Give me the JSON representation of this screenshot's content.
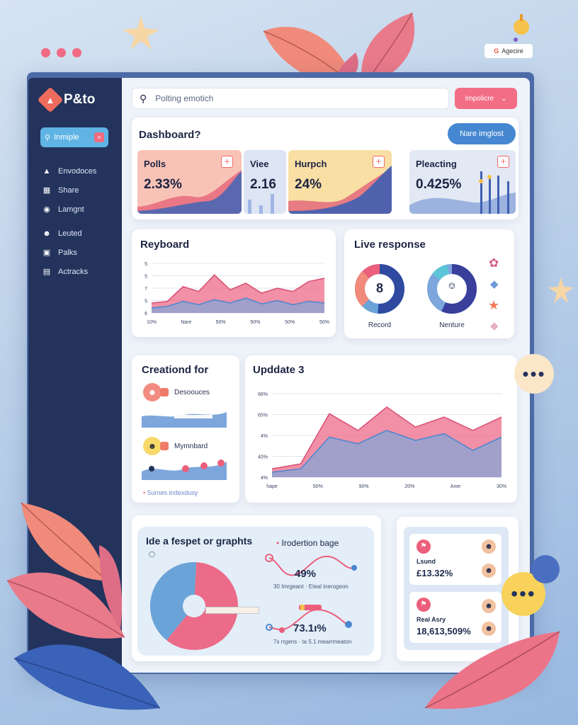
{
  "decor": {
    "top_badge": "Agecire",
    "window_dots": [
      "#f06b83",
      "#f06b83",
      "#f06b83"
    ]
  },
  "sidebar": {
    "brand": "P&to",
    "search_label": "Inmiple",
    "items": [
      {
        "icon": "home-icon",
        "label": "Envodoces"
      },
      {
        "icon": "grid-icon",
        "label": "Share"
      },
      {
        "icon": "bulb-icon",
        "label": "Lamgnt"
      },
      {
        "icon": "user-icon",
        "label": "Leuted"
      },
      {
        "icon": "inbox-icon",
        "label": "Palks"
      },
      {
        "icon": "doc-icon",
        "label": "Actracks"
      }
    ]
  },
  "topbar": {
    "search_placeholder": "Polting emotich",
    "dropdown_label": "Impolicre"
  },
  "dashboard": {
    "title": "Dashboard?",
    "new_button": "Nare imglost",
    "stats": [
      {
        "label": "Polls",
        "value": "2.33%"
      },
      {
        "label": "Viee",
        "value": "2.16"
      },
      {
        "label": "Hurpch",
        "value": "24%"
      },
      {
        "label": "Pleacting",
        "value": "0.425%"
      }
    ]
  },
  "reyboard": {
    "title": "Reyboard",
    "y_ticks": [
      "5",
      "5",
      "7",
      "5",
      "6"
    ],
    "x_ticks": [
      "10%",
      "Nare",
      "50%",
      "50%",
      "50%",
      "50%"
    ]
  },
  "live": {
    "title": "Live response",
    "donut1_value": "8",
    "donut1_label": "Record",
    "donut2_label": "Nenture"
  },
  "creation": {
    "title": "Creationd for",
    "item1": "Desoouces",
    "item2": "Mymnbard",
    "footer": "Surnes indexdusy"
  },
  "update": {
    "title": "Upddate 3",
    "y_ticks": [
      "66%",
      "65%",
      "4%",
      "40%",
      "4%"
    ],
    "x_ticks": [
      "hape",
      "50%",
      "90%",
      "20%",
      "Aner",
      "30%"
    ]
  },
  "ideas": {
    "title": "Ide a fespet or graphts",
    "pie_label": "",
    "trend_title": "Irodertion bage",
    "trend_value": "49%",
    "trend_caption": "30 Imrgeant · Eteal inerogeon",
    "second_value": "73.1ı%",
    "second_caption": "7s rrgens · ta 5.1 mearrmeaton"
  },
  "side_stats": [
    {
      "label": "Lsund",
      "value": "£13.32%"
    },
    {
      "label": "Real Asry",
      "value": "18,613,509%"
    }
  ],
  "colors": {
    "sidebar": "#23335c",
    "accent_pink": "#f26e85",
    "accent_blue": "#4587d0",
    "chart_pink": "#ec6b88",
    "chart_blue": "#7da7dc"
  },
  "chart_data": [
    {
      "type": "area",
      "title": "Reyboard",
      "categories": [
        "10%",
        "Nare",
        "50%",
        "50%",
        "50%",
        "50%"
      ],
      "series": [
        {
          "values": [
            1.2,
            1.4,
            3.2,
            2.6,
            4.6,
            2.8,
            3.6,
            2.4,
            3.0,
            2.6,
            3.8,
            4.2
          ]
        },
        {
          "values": [
            0.6,
            0.8,
            1.4,
            1.0,
            1.6,
            1.2,
            1.8,
            1.1,
            1.5,
            1.0,
            1.4,
            1.2
          ]
        }
      ],
      "ylim": [
        0,
        6
      ]
    },
    {
      "type": "area",
      "title": "Upddate 3",
      "categories": [
        "hape",
        "50%",
        "90%",
        "20%",
        "Aner",
        "30%"
      ],
      "series": [
        {
          "values": [
            0.5,
            0.8,
            3.8,
            2.8,
            4.2,
            3.0,
            3.6,
            2.8,
            3.6
          ]
        },
        {
          "values": [
            0.3,
            0.5,
            2.4,
            2.0,
            2.8,
            2.2,
            2.6,
            1.6,
            2.4
          ]
        }
      ],
      "ylim": [
        0,
        5
      ]
    },
    {
      "type": "pie",
      "values": [
        60,
        40
      ],
      "colors": [
        "#ec6b88",
        "#6aa3d8"
      ]
    }
  ]
}
